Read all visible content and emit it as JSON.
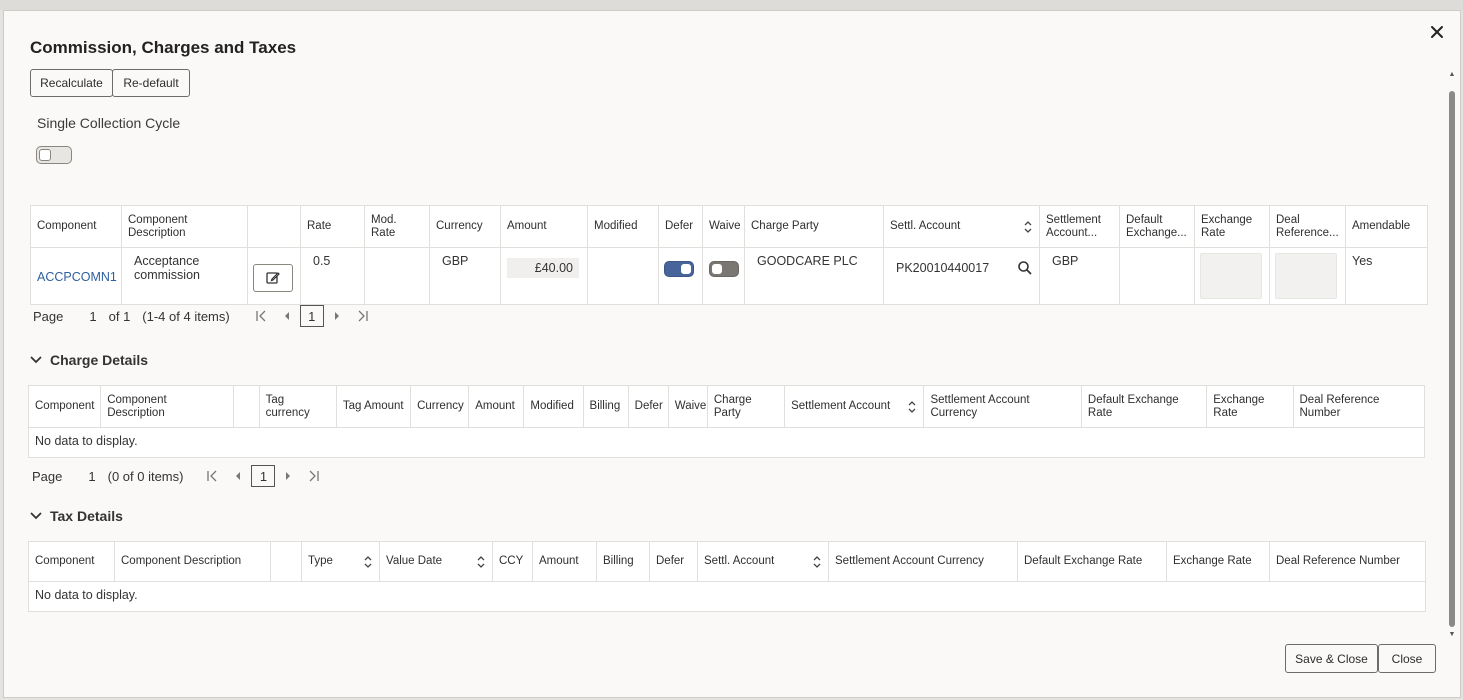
{
  "dialog": {
    "title": "Commission, Charges and Taxes",
    "recalculate_label": "Recalculate",
    "redefault_label": "Re-default",
    "single_collection_label": "Single Collection Cycle",
    "save_close_label": "Save & Close",
    "close_label": "Close"
  },
  "commission": {
    "headers": {
      "component": "Component",
      "component_description": "Component Description",
      "rate": "Rate",
      "mod_rate": "Mod. Rate",
      "currency": "Currency",
      "amount": "Amount",
      "modified": "Modified",
      "defer": "Defer",
      "waive": "Waive",
      "charge_party": "Charge Party",
      "settl_account": "Settl. Account",
      "settlement_account": "Settlement Account...",
      "default_exchange": "Default Exchange...",
      "exchange_rate": "Exchange Rate",
      "deal_reference": "Deal Reference...",
      "amendable": "Amendable"
    },
    "row": {
      "component": "ACCPCOMN1",
      "description": "Acceptance commission",
      "rate": "0.5",
      "currency": "GBP",
      "amount": "£40.00",
      "charge_party": "GOODCARE PLC",
      "settl_account": "PK20010440017",
      "settlement_currency": "GBP",
      "amendable": "Yes",
      "defer_on": true,
      "waive_on": false
    },
    "pager": {
      "page_label": "Page",
      "page_num": "1",
      "of": "of 1",
      "items": "(1-4 of 4 items)",
      "current": "1"
    }
  },
  "charge": {
    "section_title": "Charge Details",
    "headers": {
      "component": "Component",
      "component_description": "Component Description",
      "tag_currency": "Tag currency",
      "tag_amount": "Tag Amount",
      "currency": "Currency",
      "amount": "Amount",
      "modified": "Modified",
      "billing": "Billing",
      "defer": "Defer",
      "waive": "Waive",
      "charge_party": "Charge Party",
      "settlement_account": "Settlement Account",
      "settlement_account_currency": "Settlement Account Currency",
      "default_exchange_rate": "Default Exchange Rate",
      "exchange_rate": "Exchange Rate",
      "deal_reference_number": "Deal Reference Number"
    },
    "empty": "No data to display.",
    "pager": {
      "page_label": "Page",
      "page_num": "1",
      "items": "(0 of 0 items)",
      "current": "1"
    }
  },
  "tax": {
    "section_title": "Tax Details",
    "headers": {
      "component": "Component",
      "component_description": "Component Description",
      "type": "Type",
      "value_date": "Value Date",
      "ccy": "CCY",
      "amount": "Amount",
      "billing": "Billing",
      "defer": "Defer",
      "settl_account": "Settl. Account",
      "settlement_account_currency": "Settlement Account Currency",
      "default_exchange_rate": "Default Exchange Rate",
      "exchange_rate": "Exchange Rate",
      "deal_reference_number": "Deal Reference Number"
    },
    "empty": "No data to display."
  },
  "colors": {
    "link": "#2e5f9e",
    "toggle_on": "#47659b",
    "toggle_off": "#7a7672"
  }
}
